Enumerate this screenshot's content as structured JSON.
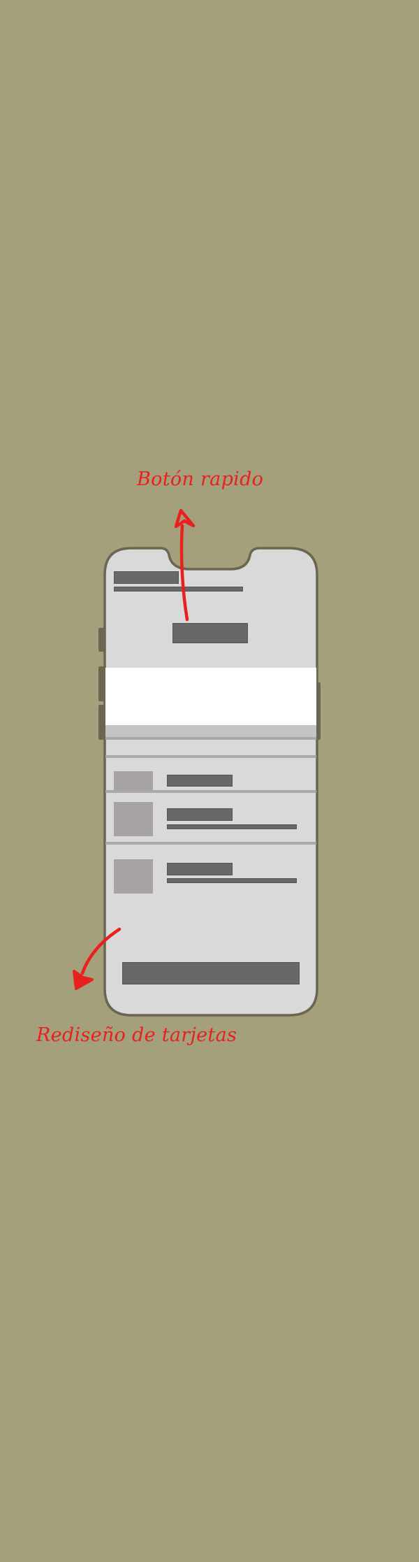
{
  "annotations": {
    "top": "Botón rapido",
    "bottom": "Rediseño de tarjetas"
  },
  "colors": {
    "background": "#a4a07c",
    "phone_screen": "#d9d9d9",
    "phone_outline": "#6a6652",
    "placeholder_dark": "#686868",
    "placeholder_thumb": "#a7a3a3",
    "annotation_red": "#e8201e"
  },
  "icons": {
    "top_arrow": "arrow-up-icon",
    "bottom_arrow": "arrow-down-left-icon"
  }
}
